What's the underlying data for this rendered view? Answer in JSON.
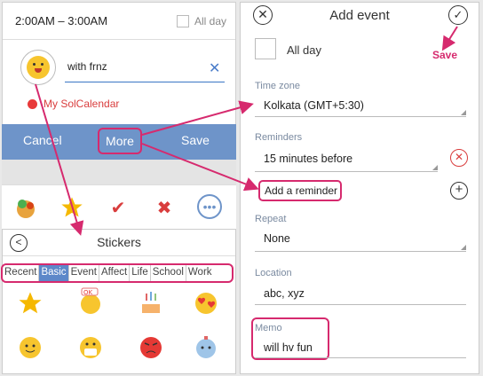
{
  "left_dialog": {
    "time_range": "2:00AM – 3:00AM",
    "all_day_label": "All day",
    "title_value": "with frnz",
    "calendar_name": "My SolCalendar",
    "buttons": {
      "cancel": "Cancel",
      "more": "More",
      "save": "Save"
    }
  },
  "icon_bar": {
    "icons": [
      "food-sticker-icon",
      "star-icon",
      "checkmark-icon",
      "close-icon",
      "more-options-icon"
    ]
  },
  "stickers": {
    "title": "Stickers",
    "tabs": [
      "Recent",
      "Basic",
      "Event",
      "Affect",
      "Life",
      "School",
      "Work"
    ],
    "active_tab": "Basic",
    "items": [
      "star-sticker",
      "ok-hand-sticker",
      "birthday-cake-sticker",
      "hearts-sticker",
      "happy-face-sticker",
      "chick-sticker",
      "angry-face-sticker",
      "water-drop-sticker"
    ]
  },
  "add_event": {
    "title": "Add event",
    "save_annotation": "Save",
    "all_day_label": "All day",
    "time_zone": {
      "label": "Time zone",
      "value": "Kolkata (GMT+5:30)"
    },
    "reminders": {
      "label": "Reminders",
      "value": "15 minutes before",
      "add_label": "Add a reminder"
    },
    "repeat": {
      "label": "Repeat",
      "value": "None"
    },
    "location": {
      "label": "Location",
      "value": "abc, xyz"
    },
    "memo": {
      "label": "Memo",
      "value": "will hv fun"
    }
  },
  "colors": {
    "accent_blue": "#6e94c9",
    "annotation_pink": "#d62a6e",
    "calendar_red": "#e83a3a"
  }
}
